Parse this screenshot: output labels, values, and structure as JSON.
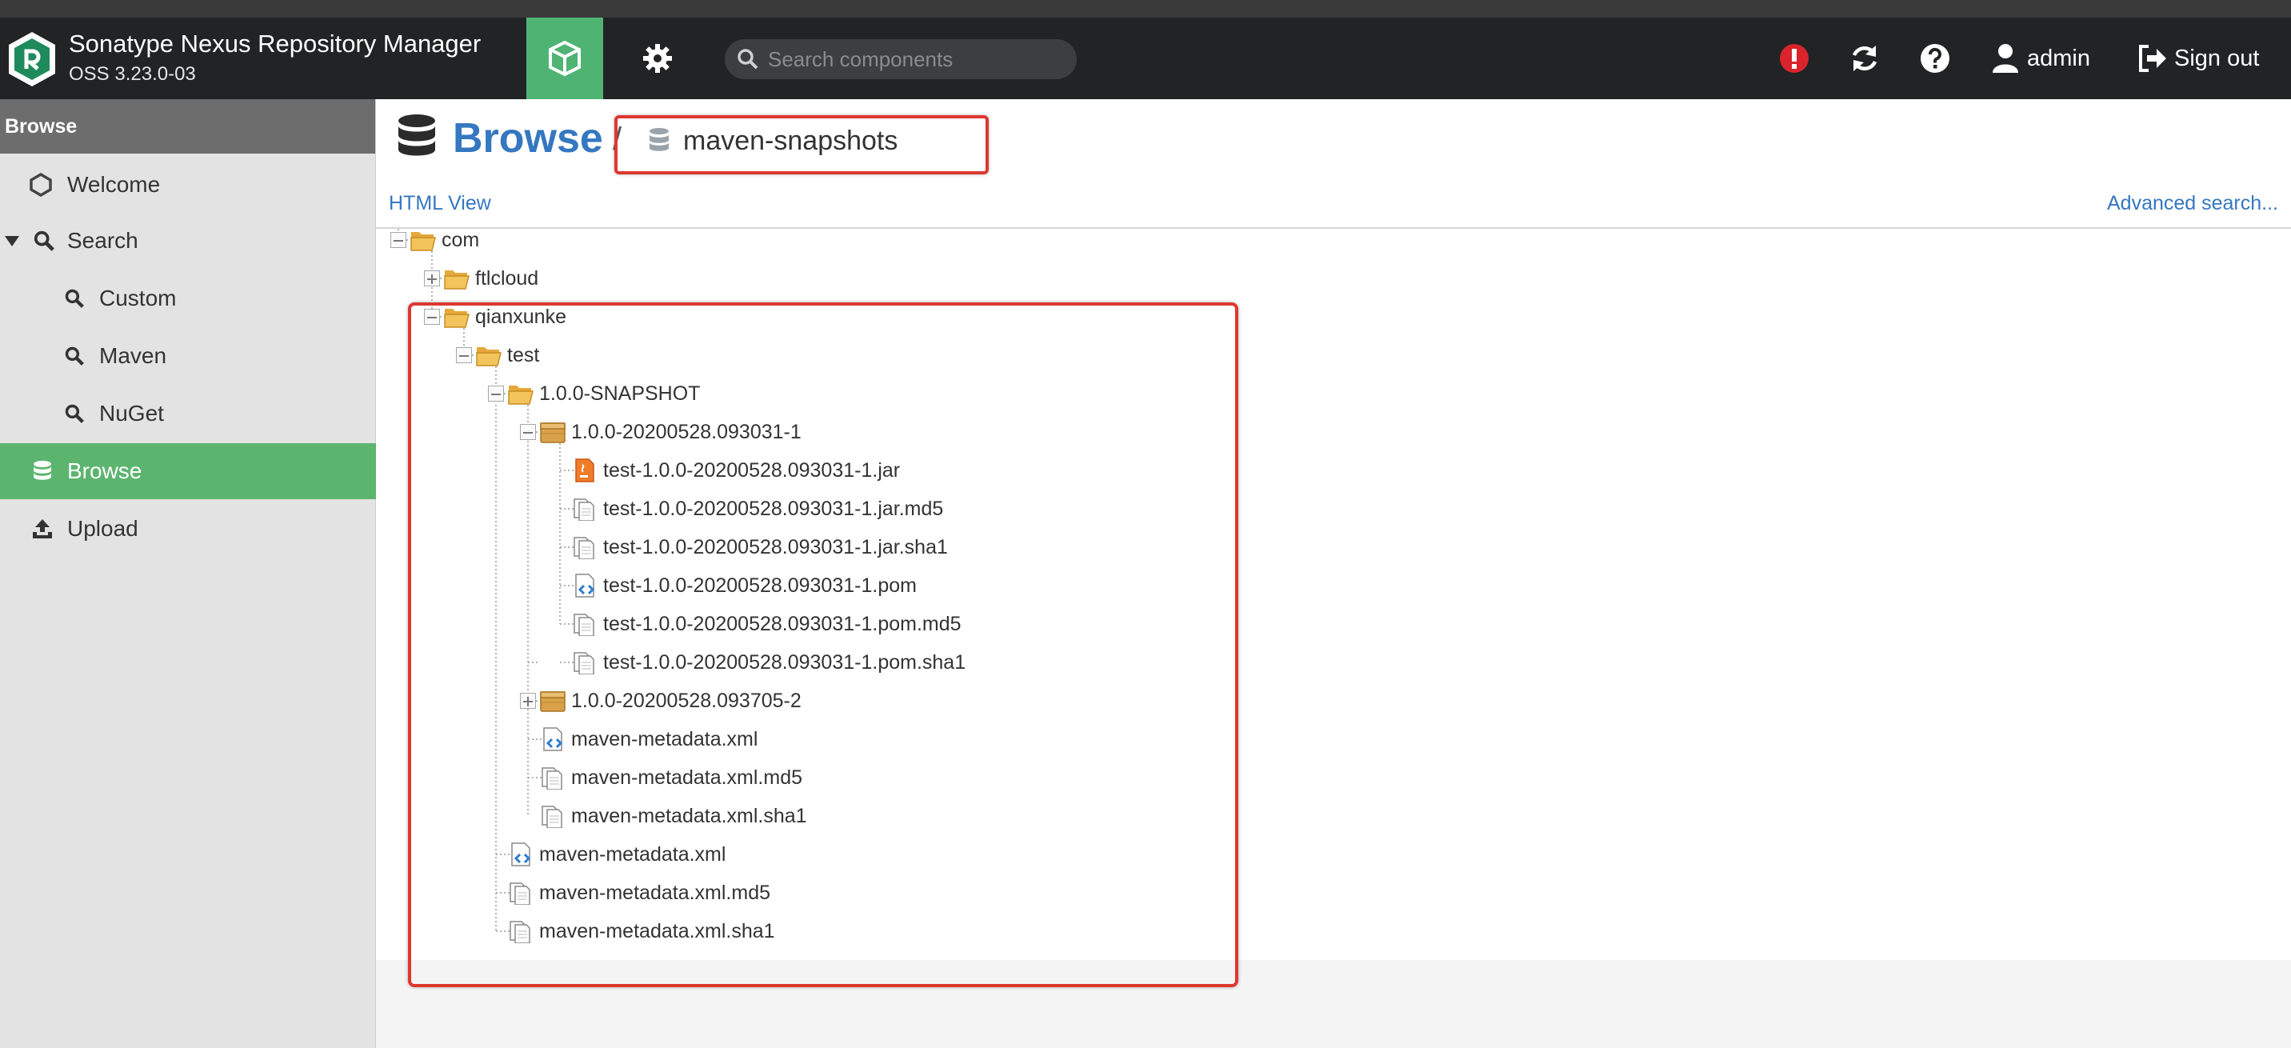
{
  "app": {
    "name": "Sonatype Nexus Repository Manager",
    "version": "OSS 3.23.0-03"
  },
  "header": {
    "search_placeholder": "Search components",
    "user": "admin",
    "signout": "Sign out"
  },
  "sidebar": {
    "title": "Browse",
    "items": [
      {
        "label": "Welcome",
        "icon": "hexagon-icon"
      },
      {
        "label": "Search",
        "icon": "search-icon"
      },
      {
        "label": "Custom",
        "icon": "search-icon"
      },
      {
        "label": "Maven",
        "icon": "search-icon"
      },
      {
        "label": "NuGet",
        "icon": "search-icon"
      },
      {
        "label": "Browse",
        "icon": "database-icon"
      },
      {
        "label": "Upload",
        "icon": "upload-icon"
      }
    ]
  },
  "main": {
    "title": "Browse",
    "repository": "maven-snapshots",
    "html_view": "HTML View",
    "advanced_search": "Advanced search..."
  },
  "tree": [
    {
      "label": "com",
      "type": "folder-open"
    },
    {
      "label": "ftlcloud",
      "type": "folder-open"
    },
    {
      "label": "qianxunke",
      "type": "folder-open"
    },
    {
      "label": "test",
      "type": "folder-open"
    },
    {
      "label": "1.0.0-SNAPSHOT",
      "type": "folder-open"
    },
    {
      "label": "1.0.0-20200528.093031-1",
      "type": "package"
    },
    {
      "label": "test-1.0.0-20200528.093031-1.jar",
      "type": "jar"
    },
    {
      "label": "test-1.0.0-20200528.093031-1.jar.md5",
      "type": "file"
    },
    {
      "label": "test-1.0.0-20200528.093031-1.jar.sha1",
      "type": "file"
    },
    {
      "label": "test-1.0.0-20200528.093031-1.pom",
      "type": "xml"
    },
    {
      "label": "test-1.0.0-20200528.093031-1.pom.md5",
      "type": "file"
    },
    {
      "label": "test-1.0.0-20200528.093031-1.pom.sha1",
      "type": "file"
    },
    {
      "label": "1.0.0-20200528.093705-2",
      "type": "package"
    },
    {
      "label": "maven-metadata.xml",
      "type": "xml"
    },
    {
      "label": "maven-metadata.xml.md5",
      "type": "file"
    },
    {
      "label": "maven-metadata.xml.sha1",
      "type": "file"
    },
    {
      "label": "maven-metadata.xml",
      "type": "xml"
    },
    {
      "label": "maven-metadata.xml.md5",
      "type": "file"
    },
    {
      "label": "maven-metadata.xml.sha1",
      "type": "file"
    }
  ],
  "colors": {
    "accent_green": "#5cb56f",
    "link_blue": "#3577c0",
    "highlight_red": "#de3730",
    "topbar": "#222324"
  }
}
